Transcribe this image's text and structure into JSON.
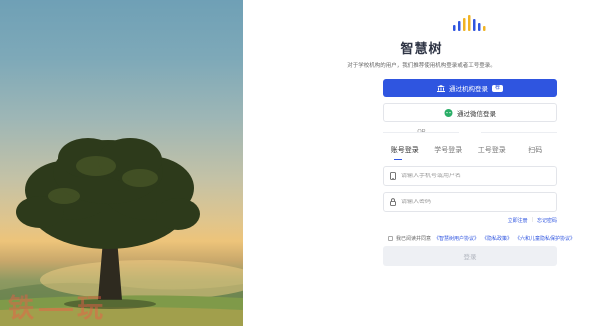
{
  "watermark": {
    "left": "铁",
    "right": "玩"
  },
  "brand": {
    "name": "智慧树"
  },
  "tagline": "对于学校机构的用户，我们推荐使用机构登录或者工号登录。",
  "buttons": {
    "institution_login": "通过机构登录",
    "institution_badge": "荐",
    "wechat_login": "通过微信登录",
    "login": "登录"
  },
  "divider": "OR",
  "tabs": [
    {
      "label": "账号登录",
      "active": true
    },
    {
      "label": "学号登录",
      "active": false
    },
    {
      "label": "工号登录",
      "active": false
    },
    {
      "label": "扫码",
      "active": false
    }
  ],
  "form": {
    "account_placeholder": "请输入手机号或用户名",
    "password_placeholder": "请输入密码"
  },
  "links": {
    "register": "立即注册",
    "separator": "|",
    "forgot": "忘记密码"
  },
  "agreement": {
    "prefix": "我已阅读并同意",
    "user_agreement": "《智慧树用户协议》",
    "privacy": "《隐私政策》",
    "children": "《六和儿童隐私保护协议》"
  },
  "colors": {
    "primary": "#2f55e0",
    "wechat": "#2aae67"
  }
}
